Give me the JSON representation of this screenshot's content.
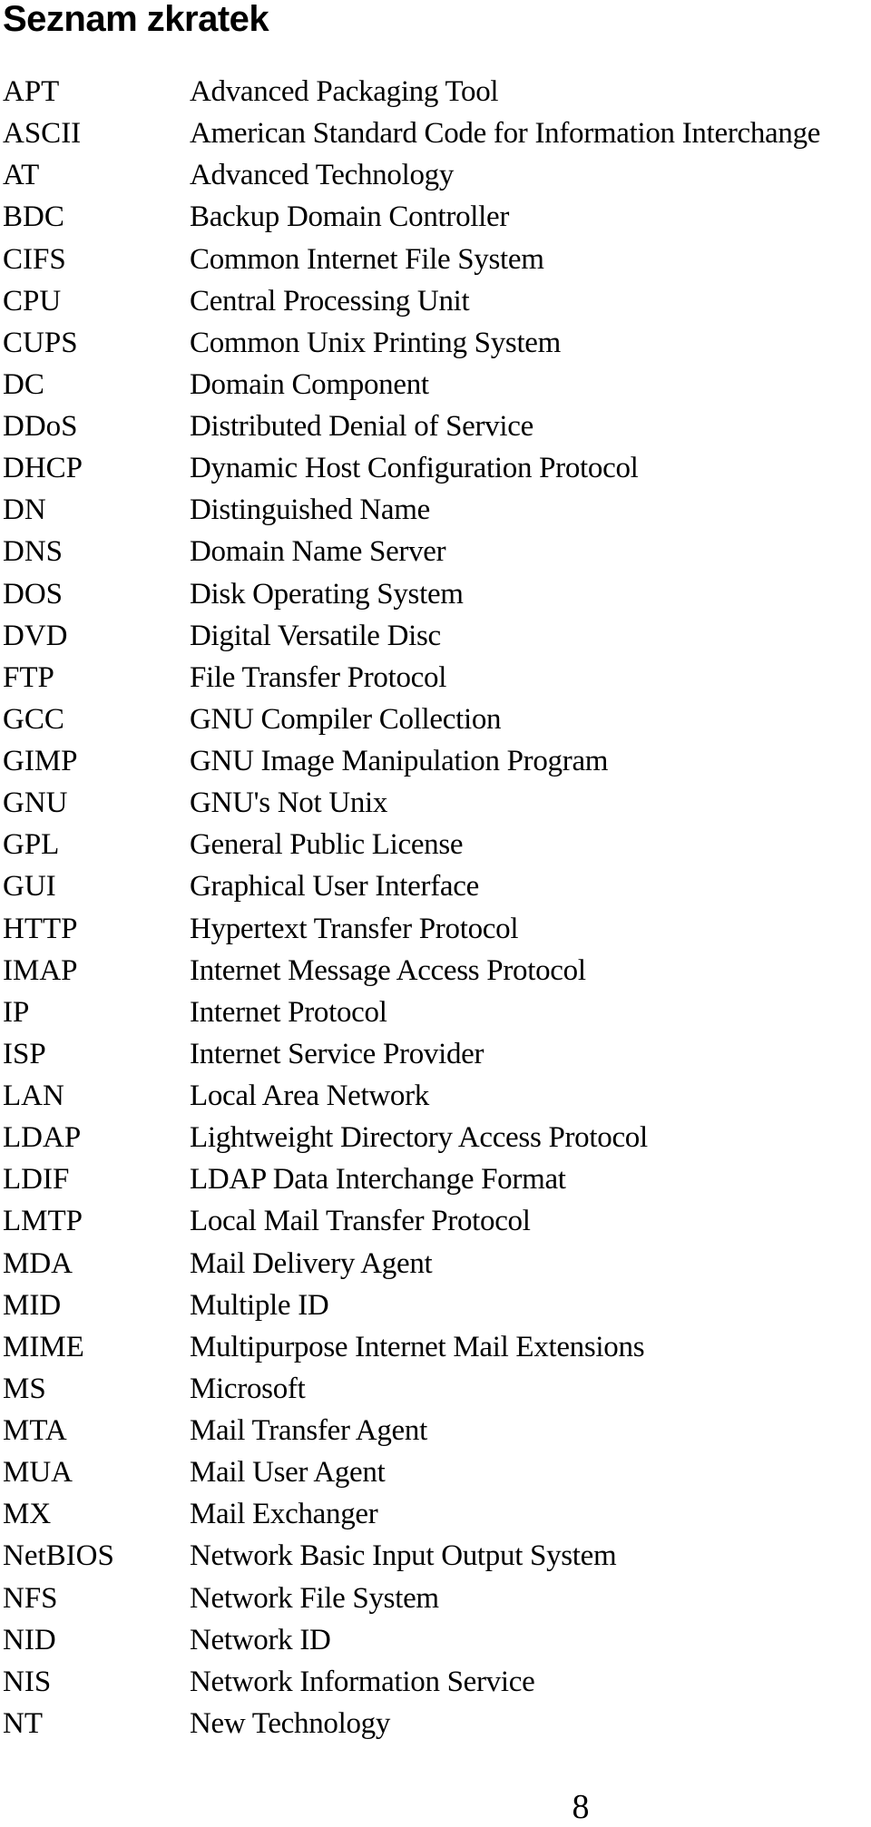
{
  "page": {
    "title": "Seznam zkratek",
    "page_number": "8"
  },
  "abbreviations": [
    {
      "term": "APT",
      "description": "Advanced Packaging Tool"
    },
    {
      "term": "ASCII",
      "description": "American Standard Code for Information Interchange"
    },
    {
      "term": "AT",
      "description": "Advanced Technology"
    },
    {
      "term": "BDC",
      "description": "Backup Domain Controller"
    },
    {
      "term": "CIFS",
      "description": "Common Internet File System"
    },
    {
      "term": "CPU",
      "description": "Central Processing Unit"
    },
    {
      "term": "CUPS",
      "description": "Common Unix Printing System"
    },
    {
      "term": "DC",
      "description": "Domain Component"
    },
    {
      "term": "DDoS",
      "description": "Distributed Denial of Service"
    },
    {
      "term": "DHCP",
      "description": "Dynamic Host Configuration Protocol"
    },
    {
      "term": "DN",
      "description": "Distinguished Name"
    },
    {
      "term": "DNS",
      "description": "Domain Name Server"
    },
    {
      "term": "DOS",
      "description": "Disk Operating System"
    },
    {
      "term": "DVD",
      "description": "Digital Versatile Disc"
    },
    {
      "term": "FTP",
      "description": "File Transfer Protocol"
    },
    {
      "term": "GCC",
      "description": "GNU Compiler Collection"
    },
    {
      "term": "GIMP",
      "description": "GNU Image Manipulation Program"
    },
    {
      "term": "GNU",
      "description": "GNU's Not Unix"
    },
    {
      "term": "GPL",
      "description": "General Public License"
    },
    {
      "term": "GUI",
      "description": "Graphical User Interface"
    },
    {
      "term": "HTTP",
      "description": "Hypertext Transfer Protocol"
    },
    {
      "term": "IMAP",
      "description": "Internet Message Access Protocol"
    },
    {
      "term": "IP",
      "description": "Internet Protocol"
    },
    {
      "term": "ISP",
      "description": "Internet Service Provider"
    },
    {
      "term": "LAN",
      "description": "Local Area Network"
    },
    {
      "term": "LDAP",
      "description": "Lightweight Directory Access Protocol"
    },
    {
      "term": "LDIF",
      "description": "LDAP Data Interchange Format"
    },
    {
      "term": "LMTP",
      "description": "Local Mail Transfer Protocol"
    },
    {
      "term": "MDA",
      "description": "Mail Delivery Agent"
    },
    {
      "term": "MID",
      "description": "Multiple ID"
    },
    {
      "term": "MIME",
      "description": "Multipurpose Internet Mail Extensions"
    },
    {
      "term": "MS",
      "description": "Microsoft"
    },
    {
      "term": "MTA",
      "description": "Mail Transfer Agent"
    },
    {
      "term": "MUA",
      "description": "Mail User Agent"
    },
    {
      "term": "MX",
      "description": "Mail Exchanger"
    },
    {
      "term": "NetBIOS",
      "description": "Network Basic Input Output System"
    },
    {
      "term": "NFS",
      "description": "Network File System"
    },
    {
      "term": "NID",
      "description": "Network ID"
    },
    {
      "term": "NIS",
      "description": "Network Information Service"
    },
    {
      "term": "NT",
      "description": "New Technology"
    }
  ]
}
